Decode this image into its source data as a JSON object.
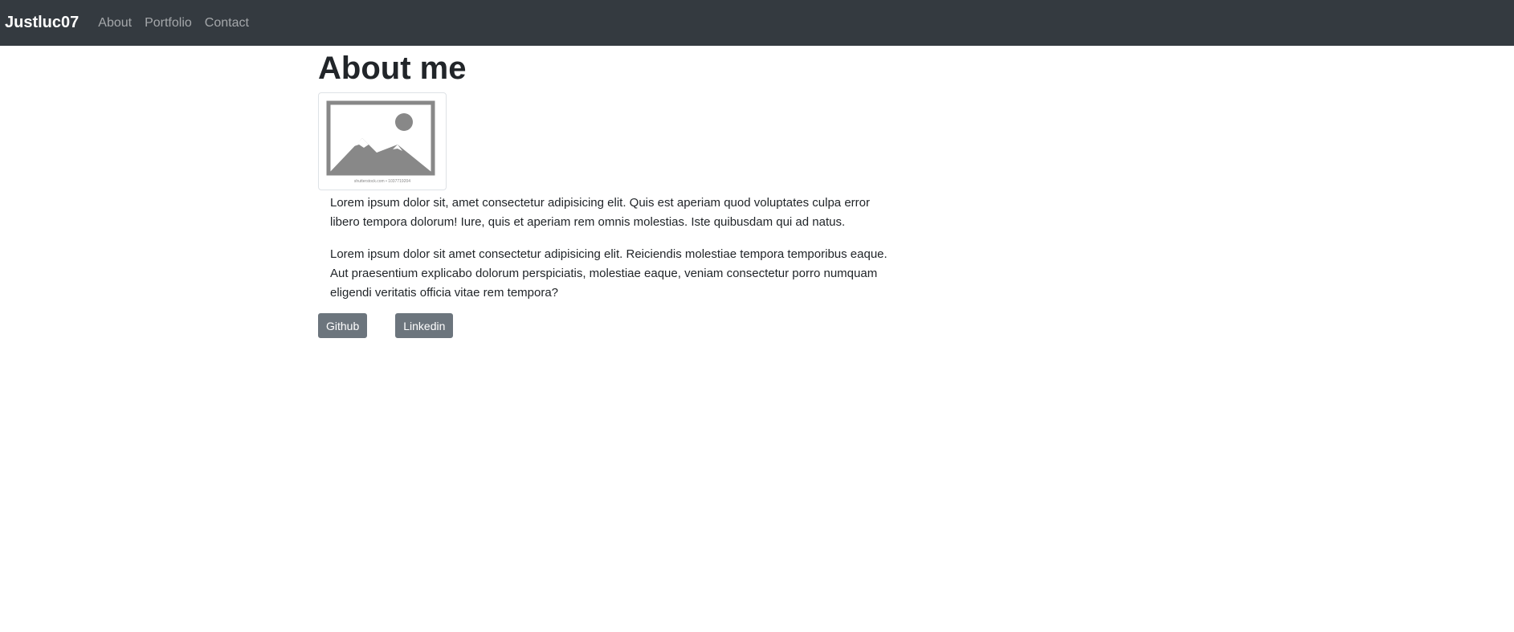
{
  "navbar": {
    "brand": "Justluc07",
    "links": [
      "About",
      "Portfolio",
      "Contact"
    ],
    "background": "#343a40"
  },
  "main": {
    "title": "About me",
    "image": {
      "icon": "image-placeholder-icon",
      "caption": "shutterstock.com • 1037719204"
    },
    "paragraphs": [
      "Lorem ipsum dolor sit, amet consectetur adipisicing elit. Quis est aperiam quod voluptates culpa error libero tempora dolorum! Iure, quis et aperiam rem omnis molestias. Iste quibusdam qui ad natus.",
      "Lorem ipsum dolor sit amet consectetur adipisicing elit. Reiciendis molestiae tempora temporibus eaque. Aut praesentium explicabo dolorum perspiciatis, molestiae eaque, veniam consectetur porro numquam eligendi veritatis officia vitae rem tempora?"
    ],
    "buttons": {
      "github": "Github",
      "linkedin": "Linkedin"
    },
    "button_color": "#6c757d"
  }
}
